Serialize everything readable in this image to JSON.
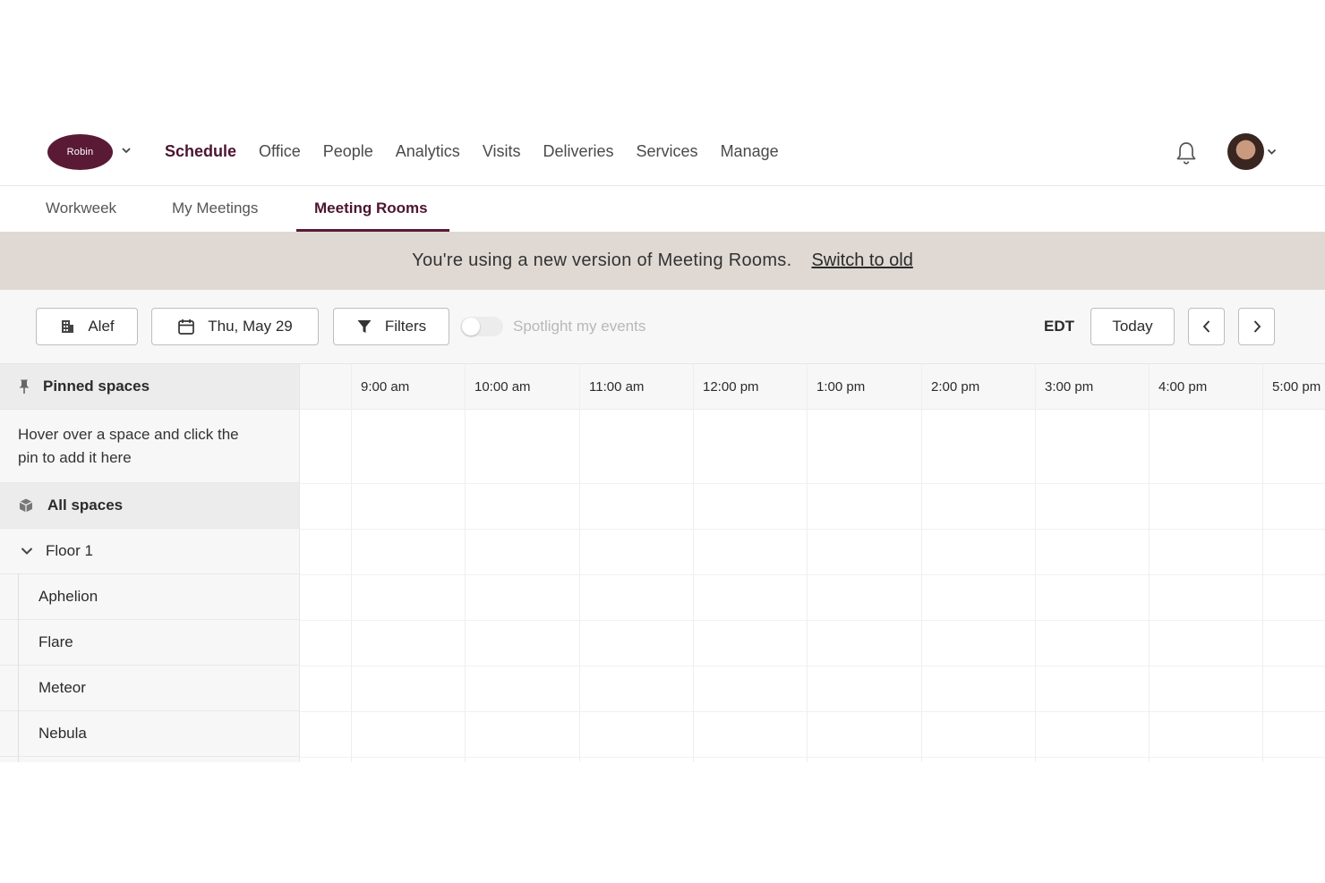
{
  "app": {
    "logo_text": "Robin",
    "brand_color": "#5a1a36"
  },
  "nav": {
    "items": [
      {
        "label": "Schedule",
        "active": true
      },
      {
        "label": "Office"
      },
      {
        "label": "People"
      },
      {
        "label": "Analytics"
      },
      {
        "label": "Visits"
      },
      {
        "label": "Deliveries"
      },
      {
        "label": "Services"
      },
      {
        "label": "Manage"
      }
    ]
  },
  "subtabs": [
    {
      "label": "Workweek"
    },
    {
      "label": "My Meetings"
    },
    {
      "label": "Meeting Rooms",
      "active": true
    }
  ],
  "banner": {
    "message": "You're using a new version of Meeting Rooms.",
    "link": "Switch to old",
    "background": "#e0d9d3"
  },
  "toolbar": {
    "building": "Alef",
    "date": "Thu, May 29",
    "filters": "Filters",
    "spotlight_label": "Spotlight my events",
    "spotlight_on": false,
    "timezone": "EDT",
    "today": "Today"
  },
  "sidebar": {
    "pinned_title": "Pinned spaces",
    "pinned_hint": "Hover over a space and click the pin to add it here",
    "all_spaces": "All spaces",
    "floor": "Floor 1",
    "rooms": [
      "Aphelion",
      "Flare",
      "Meteor",
      "Nebula"
    ]
  },
  "timeline": {
    "times": [
      "9:00 am",
      "10:00 am",
      "11:00 am",
      "12:00 pm",
      "1:00 pm",
      "2:00 pm",
      "3:00 pm",
      "4:00 pm",
      "5:00 pm"
    ]
  }
}
